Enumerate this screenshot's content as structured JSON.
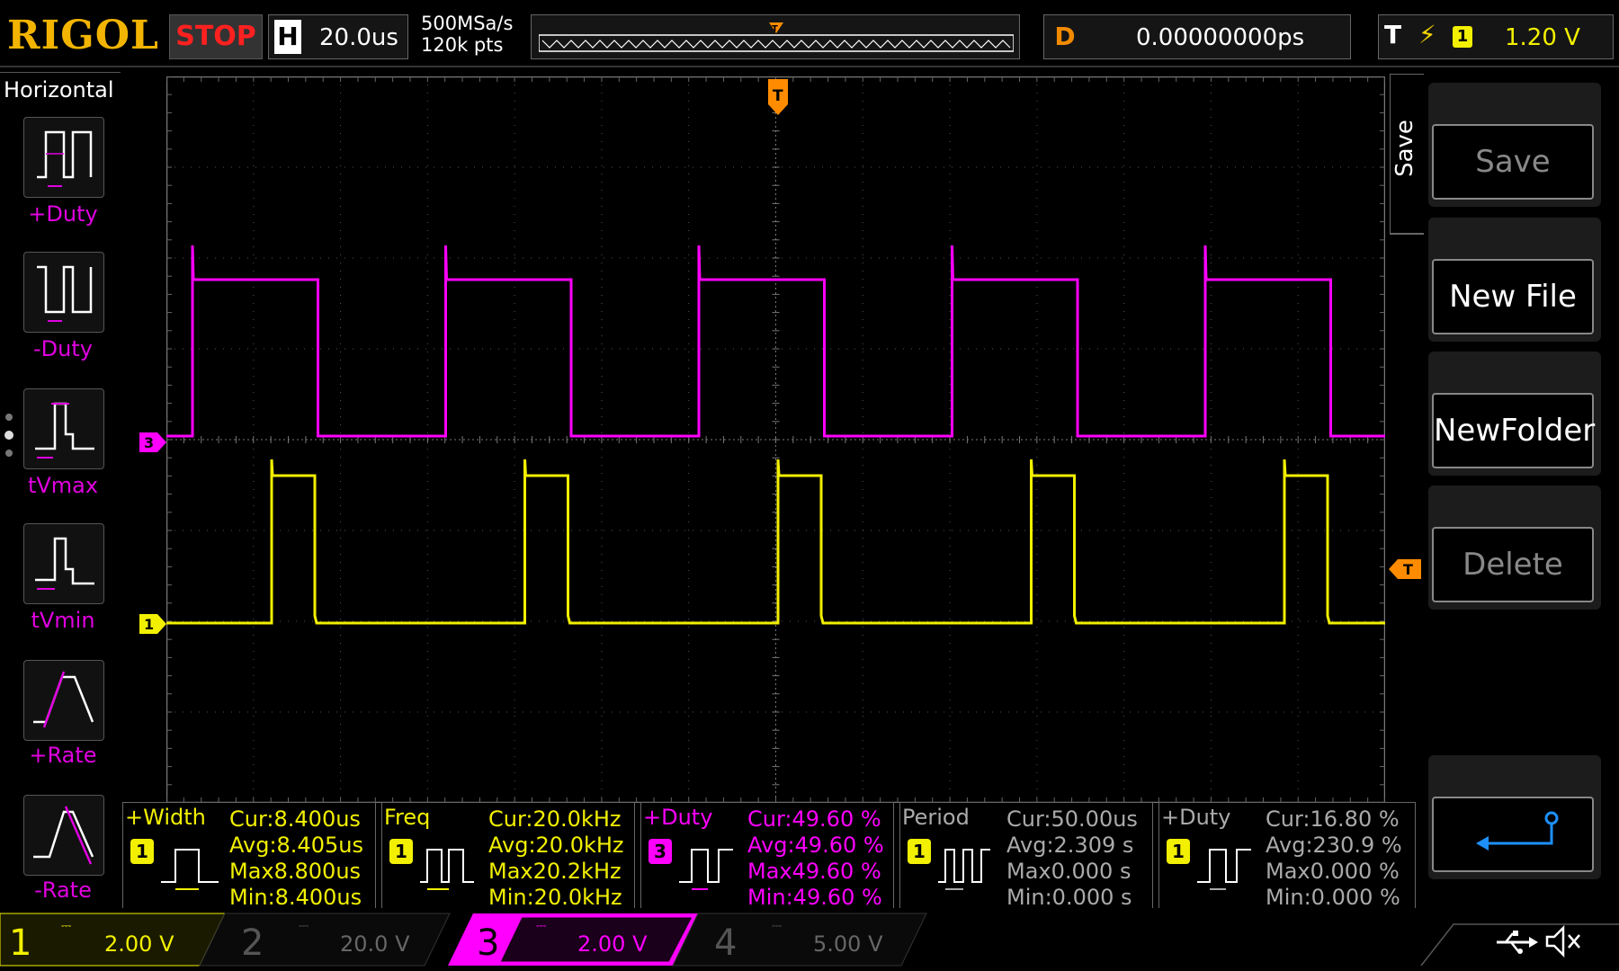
{
  "topbar": {
    "brand": "RIGOL",
    "run_status": "STOP",
    "horizontal": {
      "letter": "H",
      "timebase": "20.0us"
    },
    "sample_rate": "500MSa/s",
    "memory_depth": "120k pts",
    "delay": {
      "letter": "D",
      "value": "0.00000000ps"
    },
    "trigger": {
      "letter": "T",
      "slope_icon": "rising-edge-icon",
      "source": "1",
      "level": "1.20 V"
    }
  },
  "left_menu": {
    "title": "Horizontal",
    "items": [
      {
        "label": "+Duty",
        "icon": "positive-duty-icon"
      },
      {
        "label": "-Duty",
        "icon": "negative-duty-icon"
      },
      {
        "label": "tVmax",
        "icon": "time-at-vmax-icon"
      },
      {
        "label": "tVmin",
        "icon": "time-at-vmin-icon"
      },
      {
        "label": "+Rate",
        "icon": "rise-rate-icon"
      },
      {
        "label": "-Rate",
        "icon": "fall-rate-icon"
      }
    ]
  },
  "channel_markers": {
    "ch3": "3",
    "ch1": "1",
    "trigger_level": "T",
    "trigger_pos": "T"
  },
  "right_menu": {
    "title": "Save",
    "buttons": [
      {
        "label": "Save",
        "enabled": false
      },
      {
        "label": "New File",
        "enabled": true
      },
      {
        "label": "NewFolder",
        "enabled": true
      },
      {
        "label": "Delete",
        "enabled": false
      }
    ],
    "enter_icon": "enter-arrow-icon"
  },
  "measurements": [
    {
      "name": "+Width",
      "source": "1",
      "color": "#f2f000",
      "cur": "Cur:8.400us",
      "avg": "Avg:8.405us",
      "max": "Max8.800us",
      "min": "Min:8.400us"
    },
    {
      "name": "Freq",
      "source": "1",
      "color": "#f2f000",
      "cur": "Cur:20.0kHz",
      "avg": "Avg:20.0kHz",
      "max": "Max20.2kHz",
      "min": "Min:20.0kHz"
    },
    {
      "name": "+Duty",
      "source": "3",
      "color": "#ff00ff",
      "cur": "Cur:49.60 %",
      "avg": "Avg:49.60 %",
      "max": "Max49.60 %",
      "min": "Min:49.60 %"
    },
    {
      "name": "Period",
      "source": "1",
      "color": "#f2f000",
      "cur": "Cur:50.00us",
      "avg": "Avg:2.309 s",
      "max": "Max0.000 s",
      "min": "Min:0.000 s"
    },
    {
      "name": "+Duty",
      "source": "1",
      "color": "#f2f000",
      "cur": "Cur:16.80 %",
      "avg": "Avg:230.9 %",
      "max": "Max0.000 %",
      "min": "Min:0.000 %"
    }
  ],
  "channels": [
    {
      "num": "1",
      "scale": "2.00 V",
      "active": true,
      "color": "#f2f000"
    },
    {
      "num": "2",
      "scale": "20.0 V",
      "active": false,
      "color": "#6fa8ff"
    },
    {
      "num": "3",
      "scale": "2.00 V",
      "active": true,
      "color": "#ff00ff"
    },
    {
      "num": "4",
      "scale": "5.00 V",
      "active": false,
      "color": "#4466ff"
    }
  ],
  "status_icons": [
    "usb-icon",
    "mute-speaker-icon"
  ],
  "colors": {
    "ch1": "#f2f000",
    "ch3": "#ff00ff",
    "trigger": "#ff8c00",
    "brand": "#f2b400"
  }
}
